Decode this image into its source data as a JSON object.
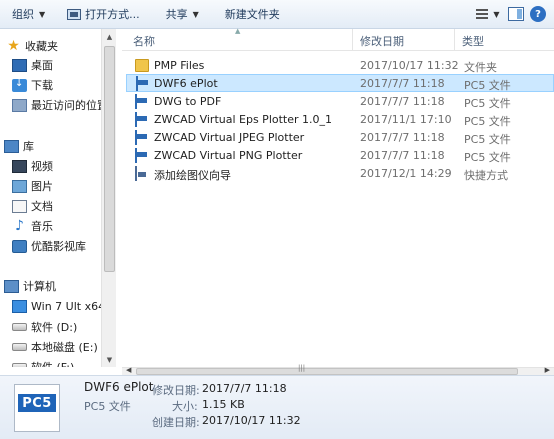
{
  "toolbar": {
    "organize": "组织",
    "open_with": "打开方式...",
    "share": "共享",
    "new_folder": "新建文件夹",
    "help": "?"
  },
  "nav": {
    "items": [
      {
        "label": "收藏夹",
        "icon": "star-icon"
      },
      {
        "label": "桌面",
        "icon": "desktop-icon"
      },
      {
        "label": "下载",
        "icon": "downloads-icon"
      },
      {
        "label": "最近访问的位置",
        "icon": "recent-places-icon"
      },
      {
        "label": "库",
        "icon": "library-icon"
      },
      {
        "label": "视频",
        "icon": "video-icon"
      },
      {
        "label": "图片",
        "icon": "pictures-icon"
      },
      {
        "label": "文档",
        "icon": "documents-icon"
      },
      {
        "label": "音乐",
        "icon": "music-icon"
      },
      {
        "label": "优酷影视库",
        "icon": "youku-library-icon"
      },
      {
        "label": "计算机",
        "icon": "computer-icon"
      },
      {
        "label": "Win 7 Ult x64",
        "icon": "windows-drive-icon"
      },
      {
        "label": "软件 (D:)",
        "icon": "drive-icon"
      },
      {
        "label": "本地磁盘 (E:)",
        "icon": "drive-icon"
      },
      {
        "label": "软件 (F:)",
        "icon": "drive-icon"
      }
    ]
  },
  "columns": {
    "name": "名称",
    "date": "修改日期",
    "type": "类型"
  },
  "files": [
    {
      "name": "PMP Files",
      "date": "2017/10/17 11:32",
      "type": "文件夹",
      "icon": "folder-icon",
      "selected": false
    },
    {
      "name": "DWF6 ePlot",
      "date": "2017/7/7 11:18",
      "type": "PC5 文件",
      "icon": "pc5-file-icon",
      "selected": true
    },
    {
      "name": "DWG to PDF",
      "date": "2017/7/7 11:18",
      "type": "PC5 文件",
      "icon": "pc5-file-icon",
      "selected": false
    },
    {
      "name": "ZWCAD Virtual Eps Plotter 1.0_1",
      "date": "2017/11/1 17:10",
      "type": "PC5 文件",
      "icon": "pc5-file-icon",
      "selected": false
    },
    {
      "name": "ZWCAD Virtual JPEG Plotter",
      "date": "2017/7/7 11:18",
      "type": "PC5 文件",
      "icon": "pc5-file-icon",
      "selected": false
    },
    {
      "name": "ZWCAD Virtual PNG Plotter",
      "date": "2017/7/7 11:18",
      "type": "PC5 文件",
      "icon": "pc5-file-icon",
      "selected": false
    },
    {
      "name": "添加绘图仪向导",
      "date": "2017/12/1 14:29",
      "type": "快捷方式",
      "icon": "shortcut-wizard-icon",
      "selected": false
    }
  ],
  "details": {
    "icon_text": "PC5",
    "name": "DWF6 ePlot",
    "type": "PC5 文件",
    "modified_label": "修改日期:",
    "modified_value": "2017/7/7 11:18",
    "size_label": "大小:",
    "size_value": "1.15 KB",
    "created_label": "创建日期:",
    "created_value": "2017/10/17 11:32"
  },
  "colors": {
    "selection": "#cce8ff",
    "selection_border": "#99d1ff",
    "toolbar_text": "#1e395b",
    "header_text": "#4c607a"
  }
}
